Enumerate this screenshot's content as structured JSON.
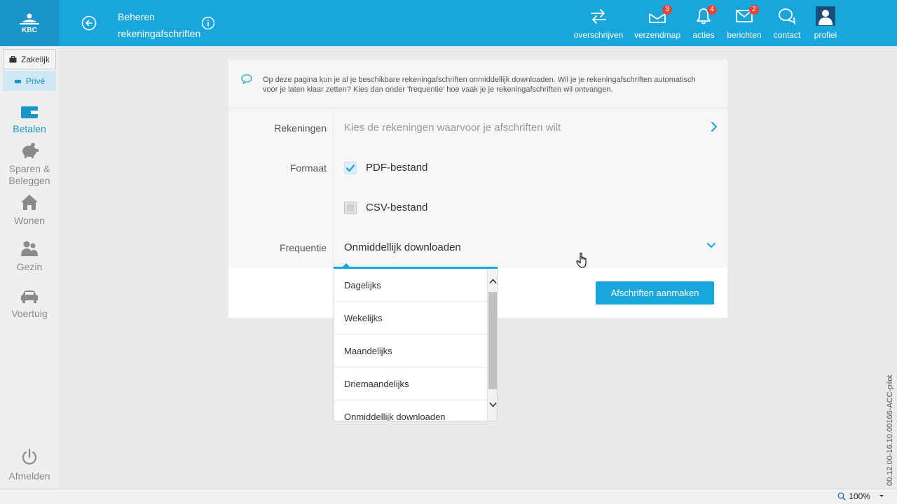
{
  "header": {
    "logo_text": "KBC",
    "title": "Beheren rekeningafschriften",
    "nav": [
      {
        "label": "overschrijven",
        "icon": "transfer-icon",
        "badge": ""
      },
      {
        "label": "verzendmap",
        "icon": "outbox-icon",
        "badge": "3"
      },
      {
        "label": "acties",
        "icon": "bell-icon",
        "badge": "4"
      },
      {
        "label": "berichten",
        "icon": "envelope-icon",
        "badge": "2"
      },
      {
        "label": "contact",
        "icon": "chat-icon",
        "badge": ""
      },
      {
        "label": "profiel",
        "icon": "avatar-icon",
        "badge": ""
      }
    ]
  },
  "sidebar": {
    "segment": {
      "business": "Zakelijk",
      "private": "Privé",
      "active": "private"
    },
    "items": [
      {
        "label": "Betalen",
        "icon": "wallet-icon",
        "active": true
      },
      {
        "label": "Sparen & Beleggen",
        "icon": "piggy-bank-icon",
        "active": false
      },
      {
        "label": "Wonen",
        "icon": "house-icon",
        "active": false
      },
      {
        "label": "Gezin",
        "icon": "family-icon",
        "active": false
      },
      {
        "label": "Voertuig",
        "icon": "car-icon",
        "active": false
      }
    ],
    "logout": "Afmelden"
  },
  "intro": "Op deze pagina kun je al je beschikbare rekeningafschriften onmiddellijk downloaden. Wil je je rekeningafschriften automatisch voor je laten klaar zetten? Kies dan onder 'frequentie' hoe vaak je je rekeningafschriften wil ontvangen.",
  "form": {
    "accounts": {
      "label": "Rekeningen",
      "placeholder": "Kies de rekeningen waarvoor je afschriften wilt"
    },
    "format": {
      "label": "Formaat",
      "options": [
        {
          "label": "PDF-bestand",
          "checked": true
        },
        {
          "label": "CSV-bestand",
          "checked": false
        }
      ]
    },
    "frequency": {
      "label": "Frequentie",
      "value": "Onmiddellijk downloaden",
      "options": [
        "Dagelijks",
        "Wekelijks",
        "Maandelijks",
        "Driemaandelijks",
        "Onmiddellijk downloaden"
      ]
    },
    "submit": "Afschriften aanmaken"
  },
  "status": {
    "zoom": "100%",
    "version": "00.12.00-16.10.00166-ACC-pilot"
  },
  "colors": {
    "accent": "#18a6dd",
    "header_dark": "#1b93cb",
    "badge": "#e8443a"
  }
}
